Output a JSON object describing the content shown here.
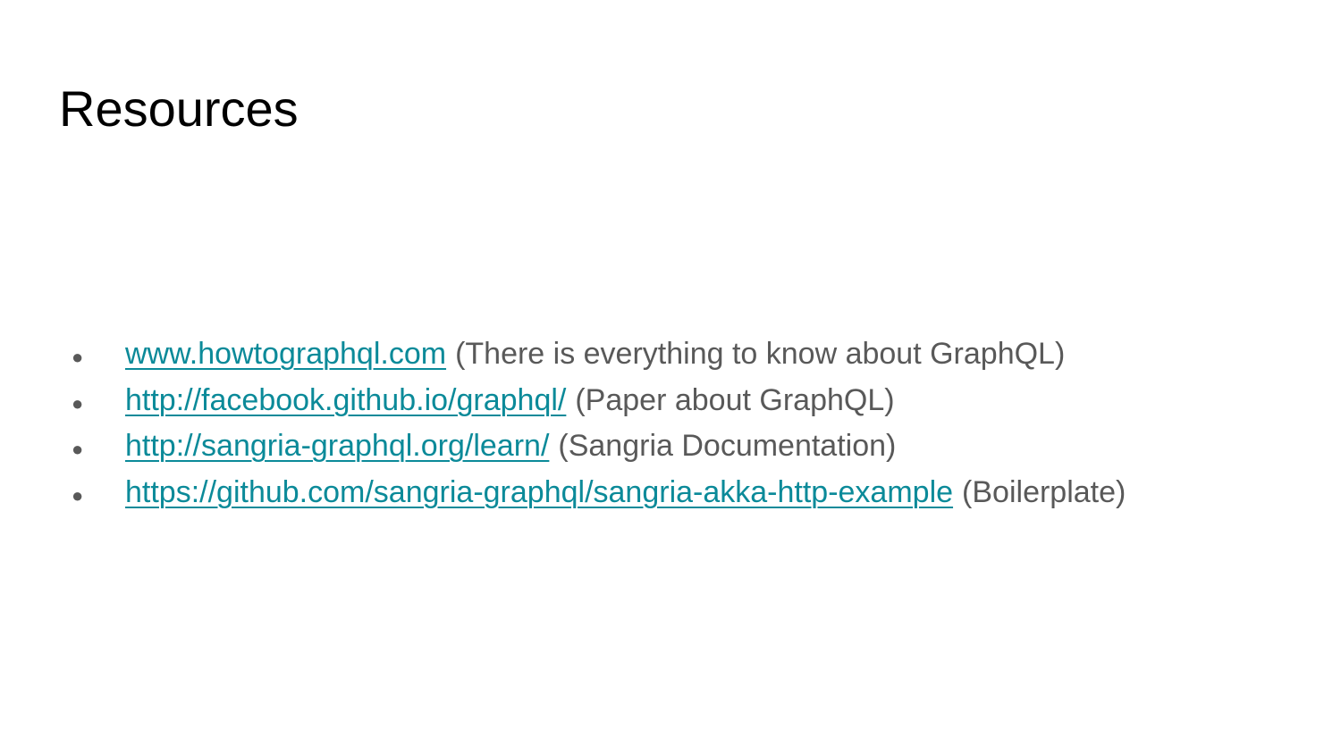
{
  "slide": {
    "title": "Resources",
    "bullet_glyph": "●",
    "link_color": "#0b8a99",
    "text_color": "#595959",
    "items": [
      {
        "link": "www.howtographql.com",
        "description": "(There is everything to know about GraphQL)"
      },
      {
        "link": "http://facebook.github.io/graphql/",
        "description": "(Paper about GraphQL)"
      },
      {
        "link": "http://sangria-graphql.org/learn/",
        "description": "(Sangria Documentation)"
      },
      {
        "link": "https://github.com/sangria-graphql/sangria-akka-http-example",
        "description": "(Boilerplate)"
      }
    ]
  }
}
